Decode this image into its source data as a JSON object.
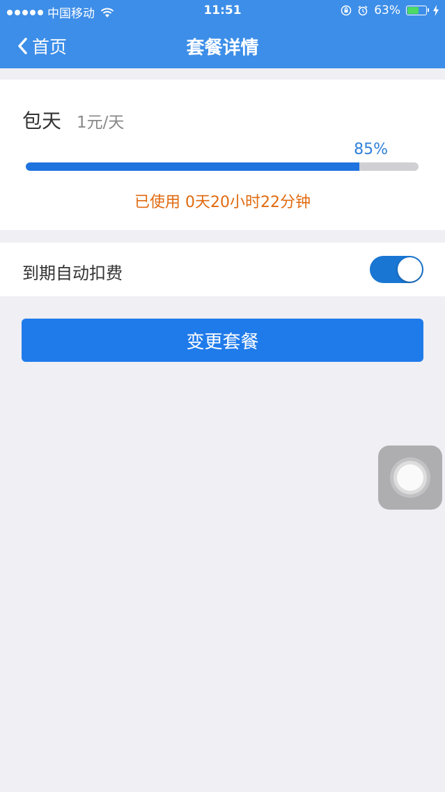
{
  "status_bar": {
    "carrier": "中国移动",
    "time": "11:51",
    "battery_percent": "63%",
    "battery_level": 0.63,
    "icons": [
      "signal-dots-icon",
      "wifi-icon",
      "orientation-lock-icon",
      "alarm-icon",
      "battery-icon",
      "charging-bolt-icon"
    ]
  },
  "nav": {
    "back_label": "首页",
    "title": "套餐详情"
  },
  "plan": {
    "name": "包天",
    "price": "1元/天",
    "percent_label": "85%",
    "usage_fraction": 0.85,
    "usage_text": "已使用 0天20小时22分钟"
  },
  "autopay": {
    "label": "到期自动扣费",
    "enabled": true
  },
  "actions": {
    "change_plan_label": "变更套餐"
  },
  "colors": {
    "header_bg": "#3d8ee8",
    "progress_fill": "#1e73df",
    "usage_text": "#e06a10",
    "toggle_on": "#1976d2",
    "button_bg": "#1f7bea",
    "page_bg": "#efeff4"
  }
}
